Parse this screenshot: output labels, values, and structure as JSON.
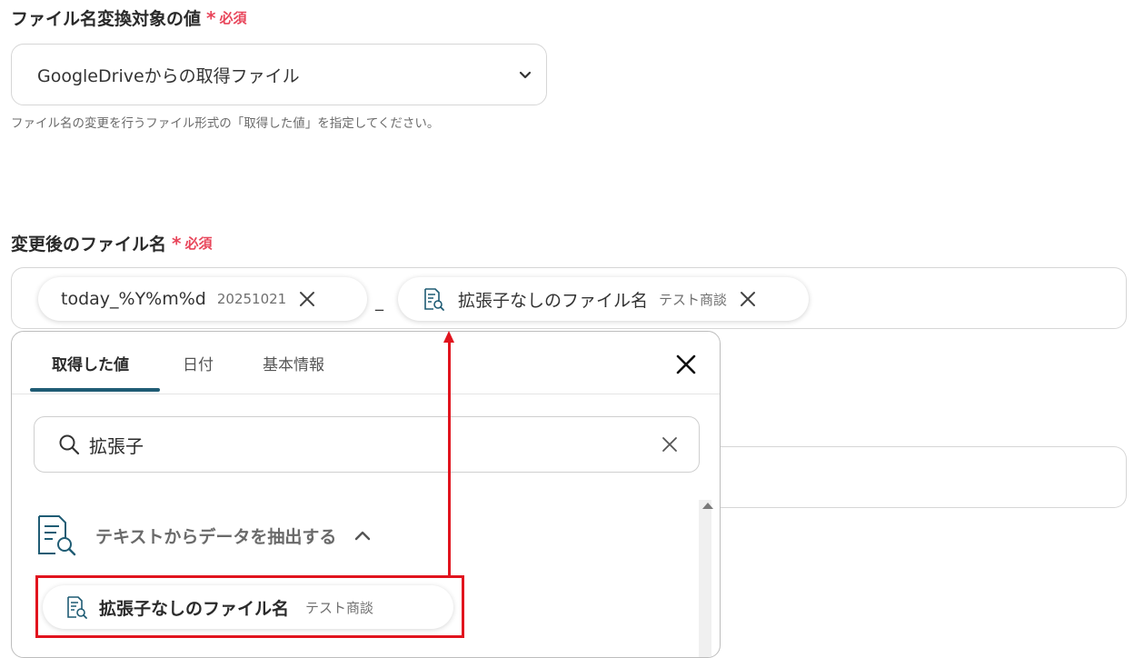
{
  "colors": {
    "required": "#e8455a",
    "accent": "#1f5c74",
    "highlight": "#e1141e"
  },
  "field1": {
    "label": "ファイル名変換対象の値",
    "required_mark": "*",
    "required_text": "必須",
    "select_value": "GoogleDriveからの取得ファイル",
    "help": "ファイル名の変更を行うファイル形式の「取得した値」を指定してください。"
  },
  "field2": {
    "label": "変更後のファイル名",
    "required_mark": "*",
    "required_text": "必須",
    "separator": "_",
    "chips": [
      {
        "label": "today_%Y%m%d",
        "sub": "20251021",
        "icon": "none"
      },
      {
        "label": "拡張子なしのファイル名",
        "sub": "テスト商談",
        "icon": "document-search-icon"
      }
    ]
  },
  "popover": {
    "tabs": [
      "取得した値",
      "日付",
      "基本情報"
    ],
    "active_tab": 0,
    "search_value": "拡張子",
    "group_title": "テキストからデータを抽出する",
    "result": {
      "label": "拡張子なしのファイル名",
      "sub": "テスト商談"
    }
  }
}
